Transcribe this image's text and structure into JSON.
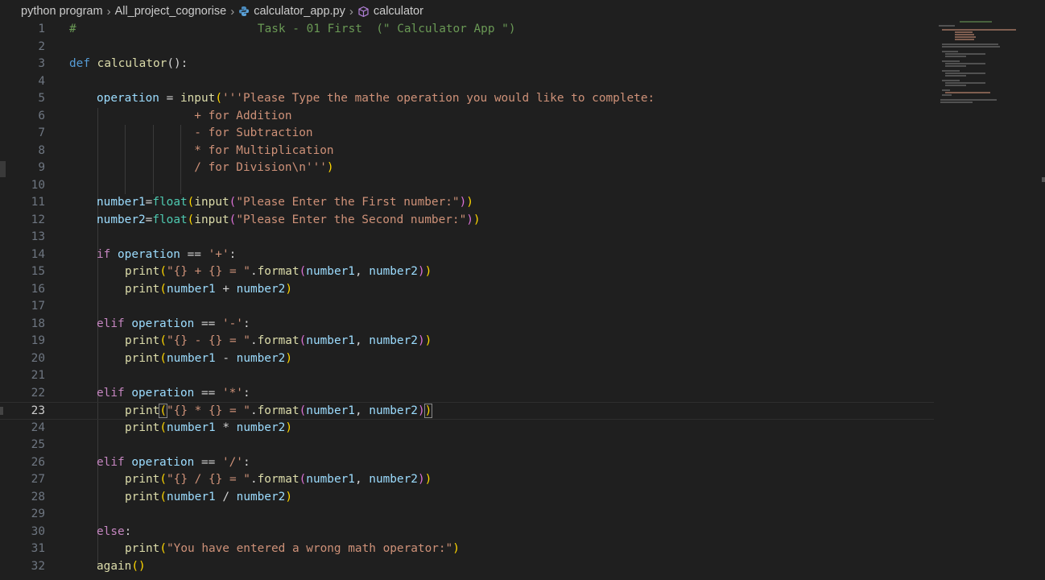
{
  "breadcrumb": {
    "items": [
      "python program",
      "All_project_cognorise",
      "calculator_app.py",
      "calculator"
    ],
    "file_icon": "python-file-icon",
    "symbol_icon": "cube-method-icon"
  },
  "editor": {
    "active_line": 23,
    "lines": [
      {
        "n": "1"
      },
      {
        "n": "2"
      },
      {
        "n": "3"
      },
      {
        "n": "4"
      },
      {
        "n": "5"
      },
      {
        "n": "6"
      },
      {
        "n": "7"
      },
      {
        "n": "8"
      },
      {
        "n": "9"
      },
      {
        "n": "10"
      },
      {
        "n": "11"
      },
      {
        "n": "12"
      },
      {
        "n": "13"
      },
      {
        "n": "14"
      },
      {
        "n": "15"
      },
      {
        "n": "16"
      },
      {
        "n": "17"
      },
      {
        "n": "18"
      },
      {
        "n": "19"
      },
      {
        "n": "20"
      },
      {
        "n": "21"
      },
      {
        "n": "22"
      },
      {
        "n": "23"
      },
      {
        "n": "24"
      },
      {
        "n": "25"
      },
      {
        "n": "26"
      },
      {
        "n": "27"
      },
      {
        "n": "28"
      },
      {
        "n": "29"
      },
      {
        "n": "30"
      },
      {
        "n": "31"
      },
      {
        "n": "32"
      }
    ]
  },
  "code": {
    "l1": {
      "t0": "#",
      "t1": "                          Task - 01 First  (\" Calculator App \")"
    },
    "l3": {
      "t0": "def",
      "t1": " ",
      "t2": "calculator",
      "t3": "():"
    },
    "l5": {
      "t0": "operation",
      "t1": " = ",
      "t2": "input",
      "t3": "(",
      "t4": "'''Please Type the mathe operation you would like to complete:"
    },
    "l6": {
      "t0": "              + for Addition"
    },
    "l7": {
      "t0": "              - for Subtraction"
    },
    "l8": {
      "t0": "              * for Multiplication"
    },
    "l9": {
      "t0": "              / for Division\\n'''",
      "t1": ")"
    },
    "l11": {
      "t0": "number1",
      "t1": "=",
      "t2": "float",
      "t3": "(",
      "t4": "input",
      "t5": "(",
      "t6": "\"Please Enter the First number:\"",
      "t7": ")",
      "t8": ")"
    },
    "l12": {
      "t0": "number2",
      "t1": "=",
      "t2": "float",
      "t3": "(",
      "t4": "input",
      "t5": "(",
      "t6": "\"Please Enter the Second number:\"",
      "t7": ")",
      "t8": ")"
    },
    "l14": {
      "t0": "if",
      "t1": " ",
      "t2": "operation",
      "t3": " == ",
      "t4": "'+'",
      "t5": ":"
    },
    "l15": {
      "t0": "print",
      "t1": "(",
      "t2": "\"{} + {} = \"",
      "t3": ".",
      "t4": "format",
      "t5": "(",
      "t6": "number1",
      "t7": ", ",
      "t8": "number2",
      "t9": ")",
      "t10": ")"
    },
    "l16": {
      "t0": "print",
      "t1": "(",
      "t2": "number1",
      "t3": " + ",
      "t4": "number2",
      "t5": ")"
    },
    "l18": {
      "t0": "elif",
      "t1": " ",
      "t2": "operation",
      "t3": " == ",
      "t4": "'-'",
      "t5": ":"
    },
    "l19": {
      "t0": "print",
      "t1": "(",
      "t2": "\"{} - {} = \"",
      "t3": ".",
      "t4": "format",
      "t5": "(",
      "t6": "number1",
      "t7": ", ",
      "t8": "number2",
      "t9": ")",
      "t10": ")"
    },
    "l20": {
      "t0": "print",
      "t1": "(",
      "t2": "number1",
      "t3": " - ",
      "t4": "number2",
      "t5": ")"
    },
    "l22": {
      "t0": "elif",
      "t1": " ",
      "t2": "operation",
      "t3": " == ",
      "t4": "'*'",
      "t5": ":"
    },
    "l23": {
      "t0": "print",
      "t1": "(",
      "t2": "\"{} * {} = \"",
      "t3": ".",
      "t4": "format",
      "t5": "(",
      "t6": "number1",
      "t7": ", ",
      "t8": "number2",
      "t9": ")",
      "t10": ")"
    },
    "l24": {
      "t0": "print",
      "t1": "(",
      "t2": "number1",
      "t3": " * ",
      "t4": "number2",
      "t5": ")"
    },
    "l26": {
      "t0": "elif",
      "t1": " ",
      "t2": "operation",
      "t3": " == ",
      "t4": "'/'",
      "t5": ":"
    },
    "l27": {
      "t0": "print",
      "t1": "(",
      "t2": "\"{} / {} = \"",
      "t3": ".",
      "t4": "format",
      "t5": "(",
      "t6": "number1",
      "t7": ", ",
      "t8": "number2",
      "t9": ")",
      "t10": ")"
    },
    "l28": {
      "t0": "print",
      "t1": "(",
      "t2": "number1",
      "t3": " / ",
      "t4": "number2",
      "t5": ")"
    },
    "l30": {
      "t0": "else",
      "t1": ":"
    },
    "l31": {
      "t0": "print",
      "t1": "(",
      "t2": "\"You have entered a wrong math operator:\"",
      "t3": ")"
    },
    "l32": {
      "t0": "again",
      "t1": "()"
    }
  },
  "theme": {
    "background": "#1f1f1f",
    "keyword": "#c586c0",
    "def_keyword": "#569cd6",
    "function": "#dcdcaa",
    "builtin": "#4ec9b0",
    "variable": "#9cdcfe",
    "string": "#ce9178",
    "comment": "#6a9955",
    "bracket1": "#ffd700",
    "bracket2": "#da70d6",
    "bracket3": "#179fff"
  }
}
